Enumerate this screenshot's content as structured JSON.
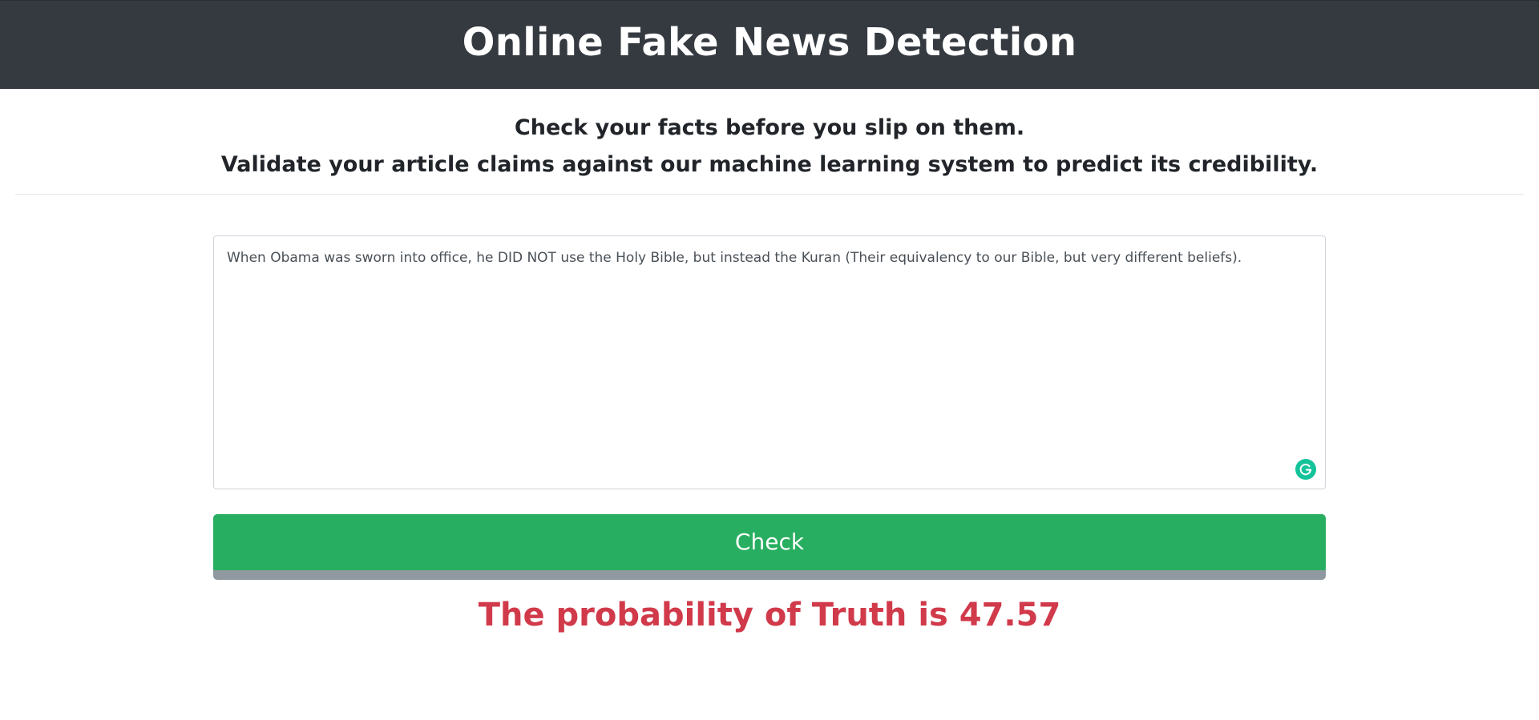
{
  "header": {
    "title": "Online Fake News Detection"
  },
  "intro": {
    "line1": "Check your facts before you slip on them.",
    "line2": "Validate your article claims against our machine learning system to predict its credibility."
  },
  "article": {
    "value": "When Obama was sworn into office, he DID NOT use the Holy Bible, but instead the Kuran (Their equivalency to our Bible, but very different beliefs).",
    "grammarly_icon": "grammarly-icon"
  },
  "check_button": {
    "label": "Check"
  },
  "result": {
    "text": "The probability of Truth is 47.57"
  },
  "colors": {
    "header_bg": "#343a40",
    "button_bg": "#28ae60",
    "result_text": "#d13a4a",
    "grammarly": "#15c39a"
  }
}
